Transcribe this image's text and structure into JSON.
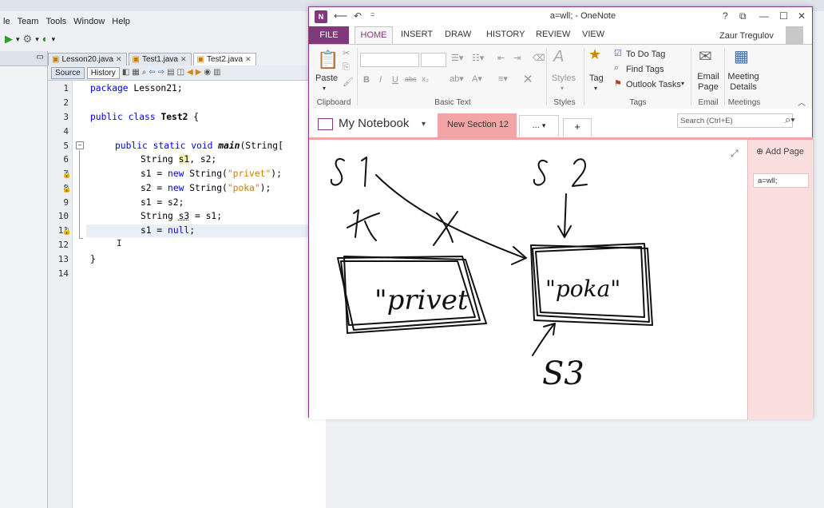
{
  "ide": {
    "menu": [
      "le",
      "Team",
      "Tools",
      "Window",
      "Help"
    ],
    "tabs": [
      {
        "label": "Lesson20.java",
        "active": false
      },
      {
        "label": "Test1.java",
        "active": false
      },
      {
        "label": "Test2.java",
        "active": true
      }
    ],
    "source_btn": "Source",
    "history_btn": "History",
    "line_numbers": [
      "1",
      "2",
      "3",
      "4",
      "5",
      "6",
      "7",
      "8",
      "9",
      "10",
      "11",
      "12",
      "13",
      "14"
    ]
  },
  "onenote": {
    "title": "a=wll; - OneNote",
    "ribbon_tabs": {
      "file": "FILE",
      "home": "HOME",
      "insert": "INSERT",
      "draw": "DRAW",
      "history": "HISTORY",
      "review": "REVIEW",
      "view": "VIEW"
    },
    "user_name": "Zaur Tregulov",
    "ribbon": {
      "paste": "Paste",
      "clipboard": "Clipboard",
      "basic_text": "Basic Text",
      "styles_btn": "Styles",
      "styles": "Styles",
      "tag_btn": "Tag",
      "to_do_tag": "To Do Tag",
      "find_tags": "Find Tags",
      "outlook_tasks": "Outlook Tasks",
      "tags": "Tags",
      "email_page": "Email Page",
      "email": "Email",
      "meeting_details": "Meeting Details",
      "meetings": "Meetings"
    },
    "notebook": "My Notebook",
    "section": "New Section 12",
    "section_more": "...",
    "search_placeholder": "Search (Ctrl+E)",
    "add_page": "Add Page",
    "page_entry": "a=wll;",
    "ink_labels": {
      "s1": "S 1",
      "s2": "S 2",
      "privet": "\"privet",
      "poka": "\"poka\"",
      "s3": "S3"
    }
  },
  "colors": {
    "onenote_accent": "#80397b",
    "section_tab": "#f3a4a4",
    "pages_panel": "#fbdede",
    "keyword": "#0000e6",
    "string": "#ce7b00"
  }
}
